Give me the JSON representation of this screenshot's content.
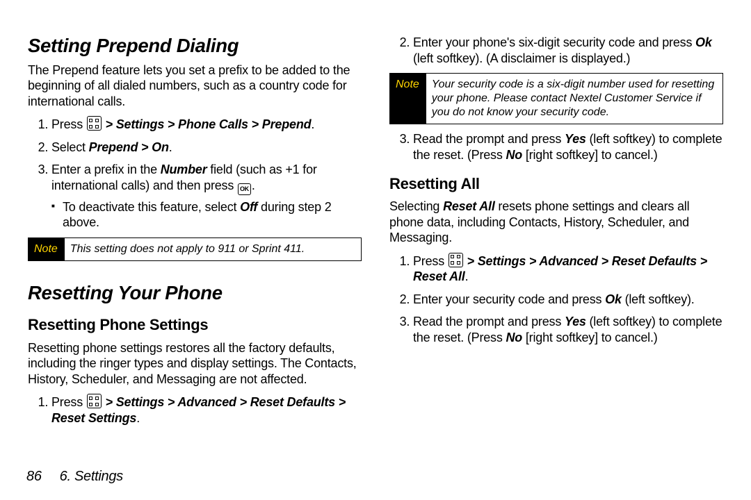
{
  "footer": {
    "page_num": "86",
    "chapter": "6. Settings"
  },
  "left": {
    "h1a": "Setting Prepend Dialing",
    "p1": "The Prepend feature lets you set a prefix to be added to the beginning of all dialed numbers, such as a country code for international calls.",
    "ol": {
      "li1_pre": "Press ",
      "li1_path": " > Settings > Phone Calls > Prepend",
      "li2_pre": "Select ",
      "li2_bold": "Prepend > On",
      "li3a": "Enter a prefix in the ",
      "li3_number": "Number",
      "li3b": " field (such as +1 for international calls) and then press ",
      "li3c": ".",
      "sub_pre": "To deactivate this feature, select ",
      "sub_off": "Off",
      "sub_post": " during step 2 above."
    },
    "note1_tag": "Note",
    "note1_body": "This setting does not apply to 911 or Sprint 411.",
    "h1b": "Resetting Your Phone",
    "h2a": "Resetting Phone Settings",
    "p2": "Resetting phone settings restores all the factory defaults, including the ringer types and display settings. The Contacts, History, Scheduler, and Messaging are not affected.",
    "ol2": {
      "li1_pre": "Press ",
      "li1_path": " > Settings > Advanced > Reset Defaults > Reset Settings"
    }
  },
  "right": {
    "ol_cont": {
      "li2a": "Enter your phone's six-digit security code and press ",
      "li2_ok": "Ok",
      "li2b": " (left softkey).  (A disclaimer is displayed.)"
    },
    "note2_tag": "Note",
    "note2_body": "Your security code is a six-digit number used for resetting your phone. Please contact Nextel Customer Service if you do not know your security code.",
    "ol_cont2": {
      "li3a": "Read the prompt and press ",
      "li3_yes": "Yes",
      "li3b": " (left softkey) to complete the reset. (Press ",
      "li3_no": "No",
      "li3c": " [right softkey] to cancel.)"
    },
    "h2b": "Resetting All",
    "p3a": "Selecting ",
    "p3_reset_all": "Reset All",
    "p3b": " resets phone settings and clears all phone data, including Contacts, History, Scheduler, and Messaging.",
    "olB": {
      "li1_pre": "Press ",
      "li1_path": " > Settings > Advanced > Reset Defaults > Reset All",
      "li2a": "Enter your security code and press ",
      "li2_ok": "Ok",
      "li2b": " (left softkey).",
      "li3a": "Read the prompt and press ",
      "li3_yes": "Yes",
      "li3b": " (left softkey) to complete the reset. (Press ",
      "li3_no": "No",
      "li3c": " [right softkey] to cancel.)"
    }
  }
}
